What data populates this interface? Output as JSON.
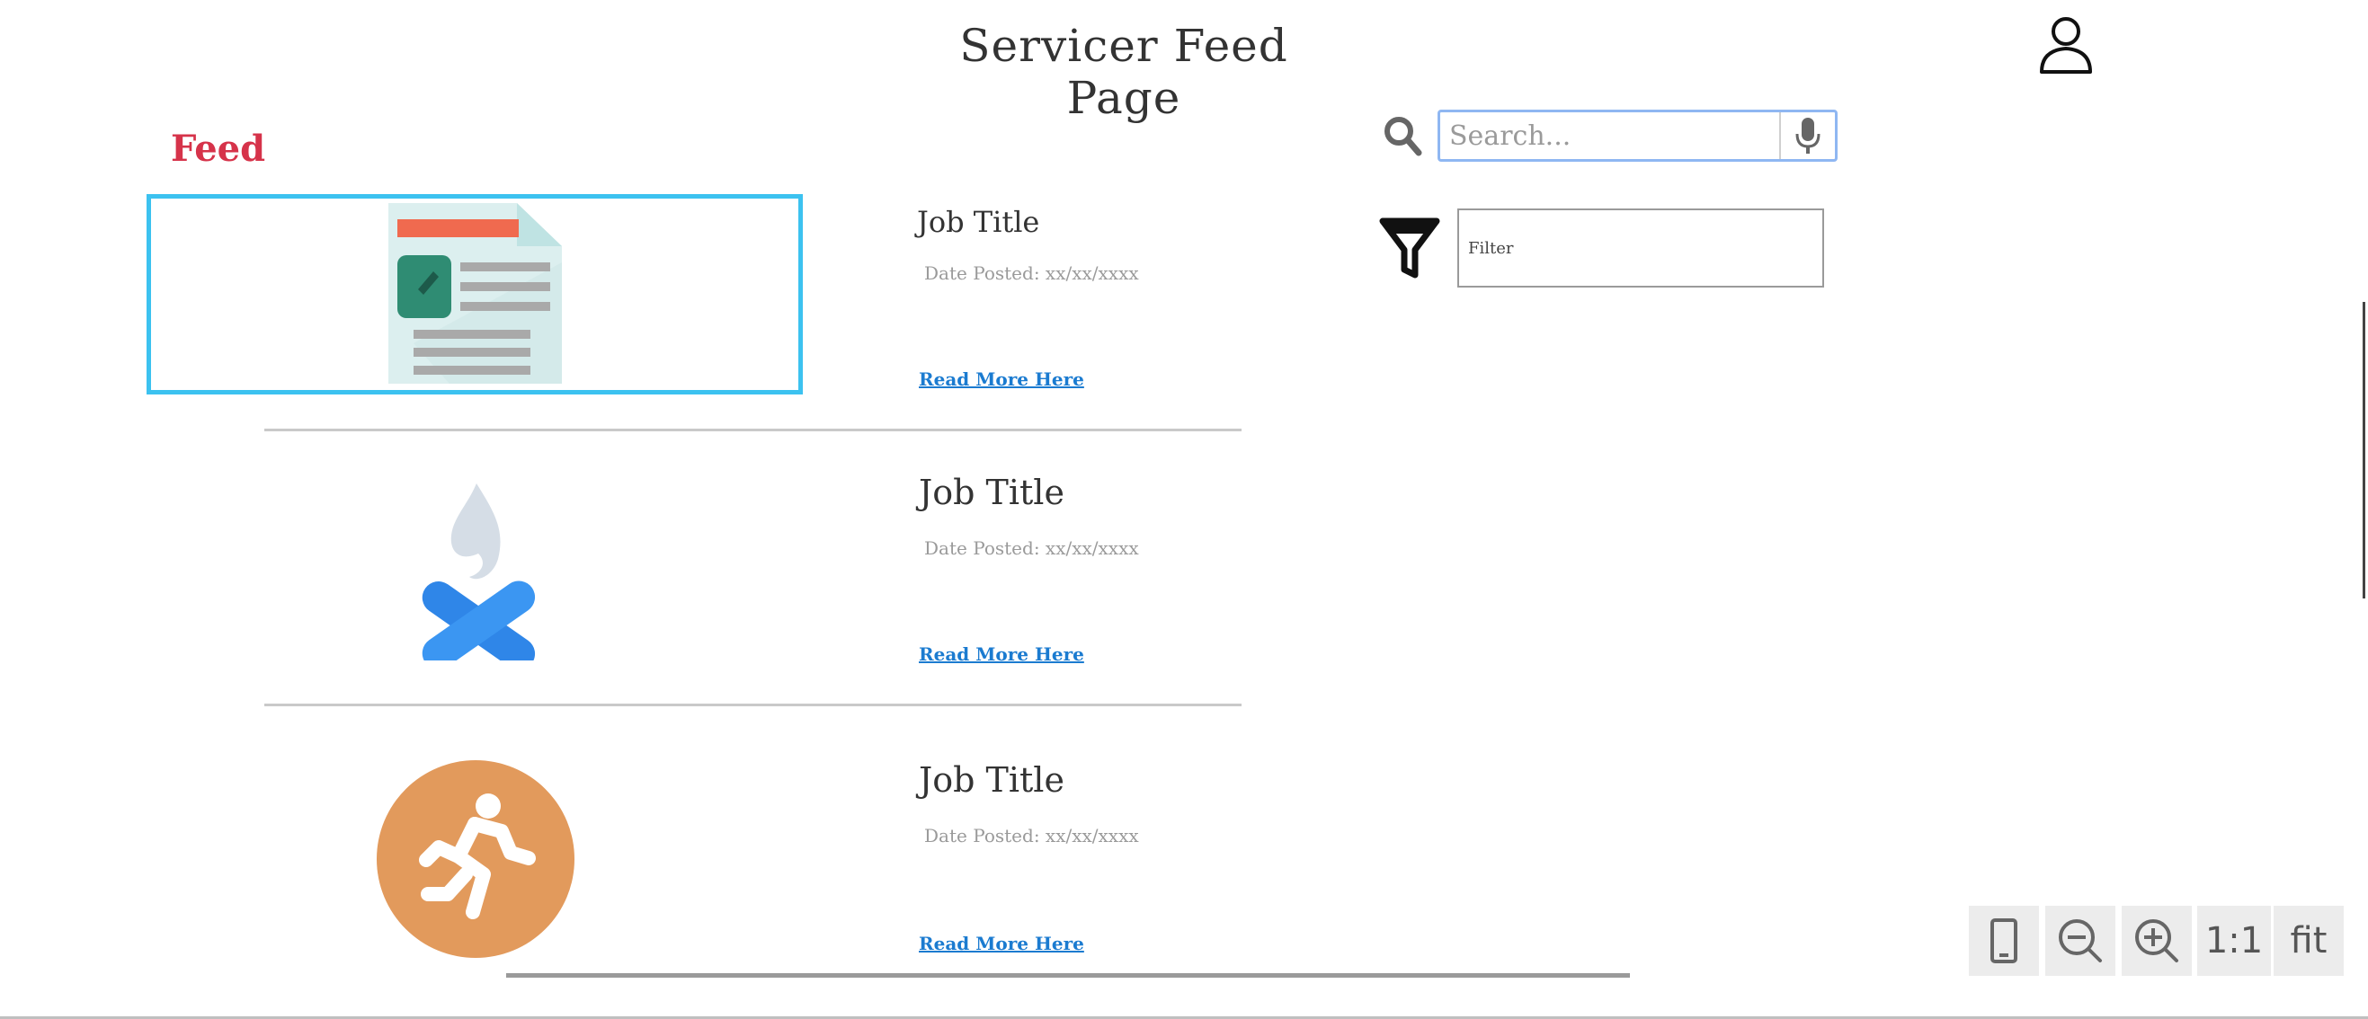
{
  "page": {
    "title": "Servicer Feed Page"
  },
  "feed": {
    "label": "Feed",
    "items": [
      {
        "title": "Job Title",
        "date": "Date Posted: xx/xx/xxxx",
        "link": "Read More Here",
        "image_icon": "document-icon"
      },
      {
        "title": "Job Title",
        "date": "Date Posted: xx/xx/xxxx",
        "link": "Read More Here",
        "image_icon": "campfire-icon"
      },
      {
        "title": "Job Title",
        "date": "Date Posted: xx/xx/xxxx",
        "link": "Read More Here",
        "image_icon": "running-person-icon"
      }
    ]
  },
  "search": {
    "placeholder": "Search...",
    "search_icon": "search-icon",
    "mic_icon": "microphone-icon"
  },
  "filter": {
    "value": "Filter",
    "icon": "funnel-icon"
  },
  "header": {
    "user_icon": "user-icon"
  },
  "zoom_controls": {
    "device_icon": "device-icon",
    "zoom_out_icon": "zoom-out-icon",
    "zoom_in_icon": "zoom-in-icon",
    "actual_size_label": "1:1",
    "fit_label": "fit"
  },
  "colors": {
    "feed_label": "#d6334a",
    "selection": "#3cc2f0",
    "link": "#1b7bd0",
    "search_border": "#8fb7f2"
  }
}
